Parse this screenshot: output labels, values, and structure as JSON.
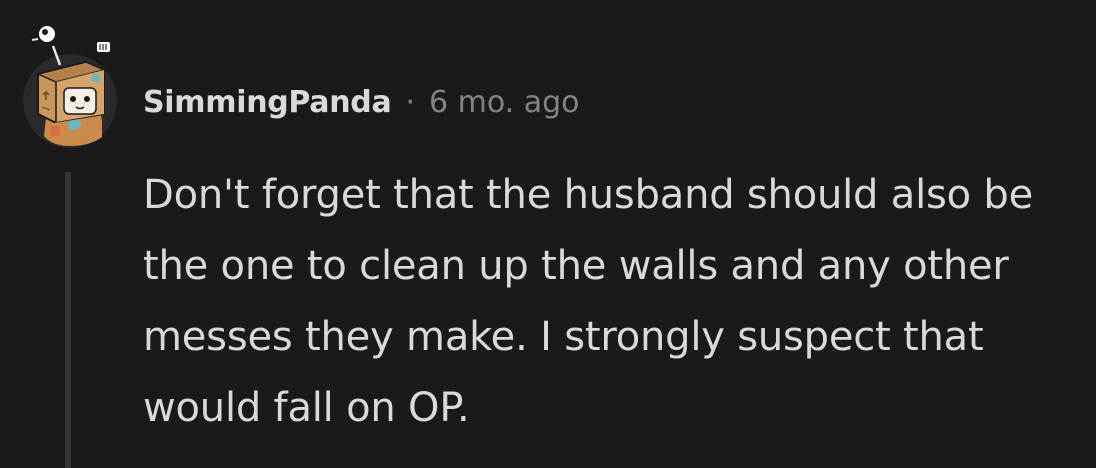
{
  "comment": {
    "username": "SimmingPanda",
    "separator": "·",
    "timestamp": "6 mo. ago",
    "avatar_icon": "snoo-box-avatar-icon",
    "body": "Don't forget that the husband should also be the one to clean up the walls and any other messes they make. I strongly suspect that would fall on OP."
  },
  "colors": {
    "background": "#1a1a1b",
    "text_primary": "#d7dadc",
    "text_secondary": "#818384",
    "thread_line": "#343536"
  }
}
